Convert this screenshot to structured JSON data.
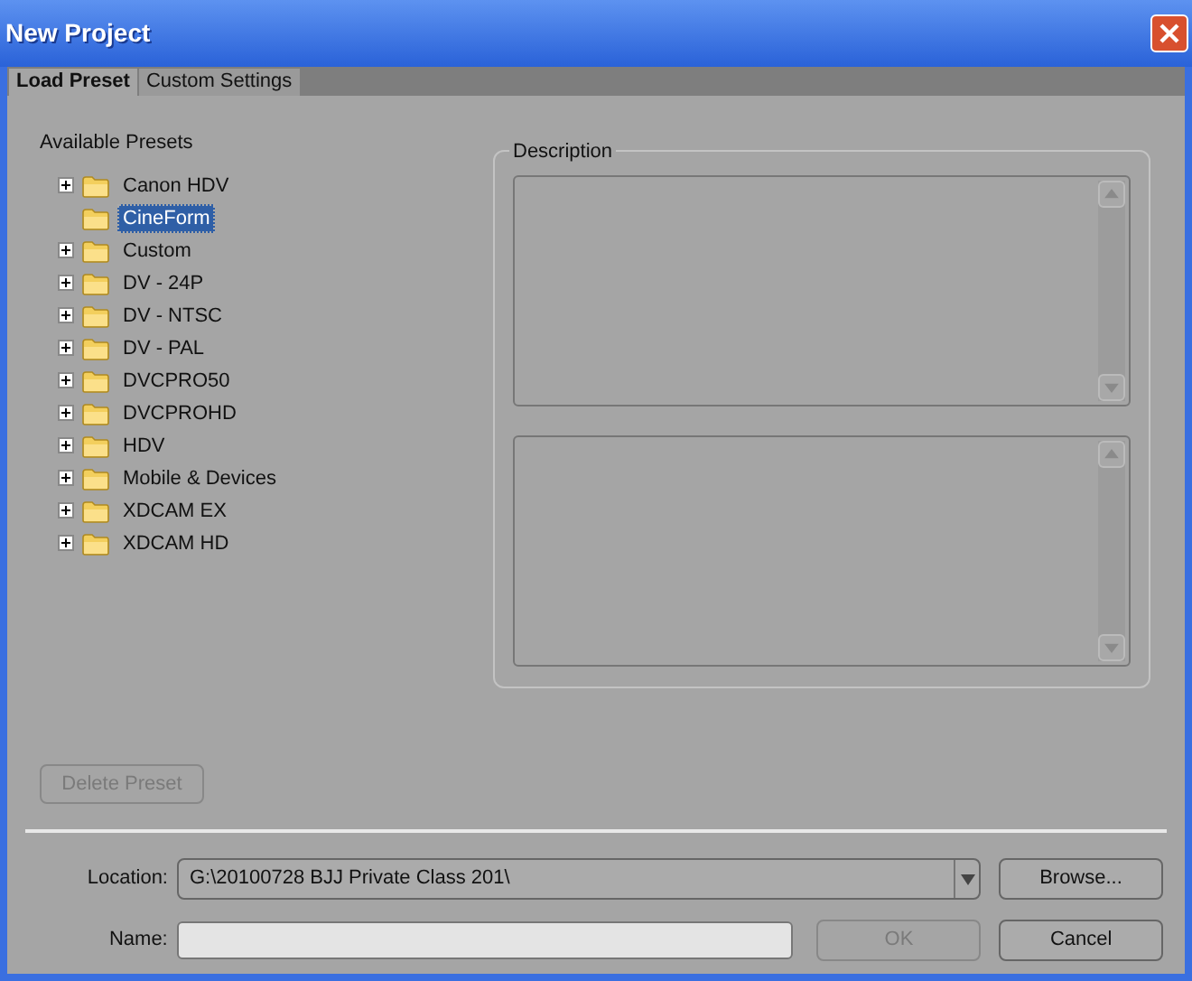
{
  "window": {
    "title": "New Project"
  },
  "tabs": [
    {
      "label": "Load Preset",
      "selected": true
    },
    {
      "label": "Custom Settings",
      "selected": false
    }
  ],
  "presets": {
    "label": "Available Presets",
    "items": [
      {
        "label": "Canon HDV",
        "expandable": true,
        "selected": false
      },
      {
        "label": "CineForm",
        "expandable": false,
        "selected": true
      },
      {
        "label": "Custom",
        "expandable": true,
        "selected": false
      },
      {
        "label": "DV - 24P",
        "expandable": true,
        "selected": false
      },
      {
        "label": "DV - NTSC",
        "expandable": true,
        "selected": false
      },
      {
        "label": "DV - PAL",
        "expandable": true,
        "selected": false
      },
      {
        "label": "DVCPRO50",
        "expandable": true,
        "selected": false
      },
      {
        "label": "DVCPROHD",
        "expandable": true,
        "selected": false
      },
      {
        "label": "HDV",
        "expandable": true,
        "selected": false
      },
      {
        "label": "Mobile & Devices",
        "expandable": true,
        "selected": false
      },
      {
        "label": "XDCAM EX",
        "expandable": true,
        "selected": false
      },
      {
        "label": "XDCAM HD",
        "expandable": true,
        "selected": false
      }
    ]
  },
  "description": {
    "label": "Description"
  },
  "delete_button": {
    "label": "Delete Preset",
    "disabled": true
  },
  "location": {
    "label": "Location:",
    "value": "G:\\20100728 BJJ Private Class 201\\"
  },
  "browse_button": {
    "label": "Browse..."
  },
  "name": {
    "label": "Name:"
  },
  "ok_button": {
    "label": "OK",
    "disabled": true
  },
  "cancel_button": {
    "label": "Cancel"
  }
}
